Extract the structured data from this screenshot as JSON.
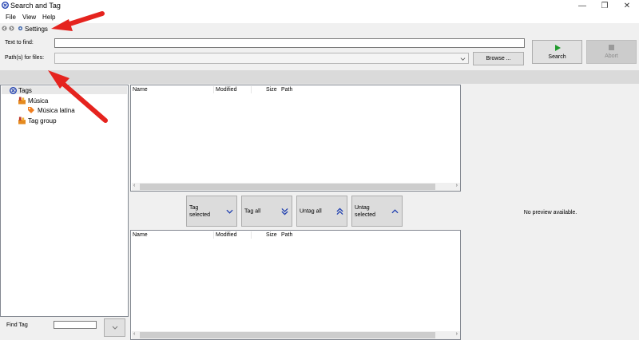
{
  "window": {
    "title": "Search and Tag",
    "controls": [
      "—",
      "❐",
      "✕"
    ]
  },
  "menu": [
    "File",
    "View",
    "Help"
  ],
  "toolstrip": {
    "settings_label": "Settings"
  },
  "search": {
    "text_label": "Text to find:",
    "text_value": "",
    "paths_label": "Path(s) for files:",
    "paths_value": "",
    "browse_label": "Browse ...",
    "search_label": "Search",
    "abort_label": "Abort"
  },
  "tree": {
    "root": "Tags",
    "children": [
      {
        "label": "Música",
        "children": [
          {
            "label": "Música latina"
          }
        ]
      },
      {
        "label": "Tag group"
      }
    ]
  },
  "results": {
    "columns": [
      "Name",
      "Modified",
      "Size",
      "Path"
    ]
  },
  "tagged": {
    "columns": [
      "Name",
      "Modified",
      "Size",
      "Path"
    ]
  },
  "tag_actions": [
    {
      "label": "Tag\nselected",
      "icon": "chevron-down-icon"
    },
    {
      "label": "Tag all",
      "icon": "double-chevron-down-icon"
    },
    {
      "label": "Untag all",
      "icon": "double-chevron-up-icon"
    },
    {
      "label": "Untag\nselected",
      "icon": "chevron-up-icon"
    }
  ],
  "preview": {
    "message": "No preview available."
  },
  "find_tag": {
    "label": "Find Tag",
    "value": ""
  },
  "colors": {
    "accent_blue": "#1f3fb0",
    "play_green": "#1f9a2c",
    "folder_orange": "#e58a1f",
    "tag_orange": "#f07e1f",
    "annotation_red": "#e5231e"
  }
}
